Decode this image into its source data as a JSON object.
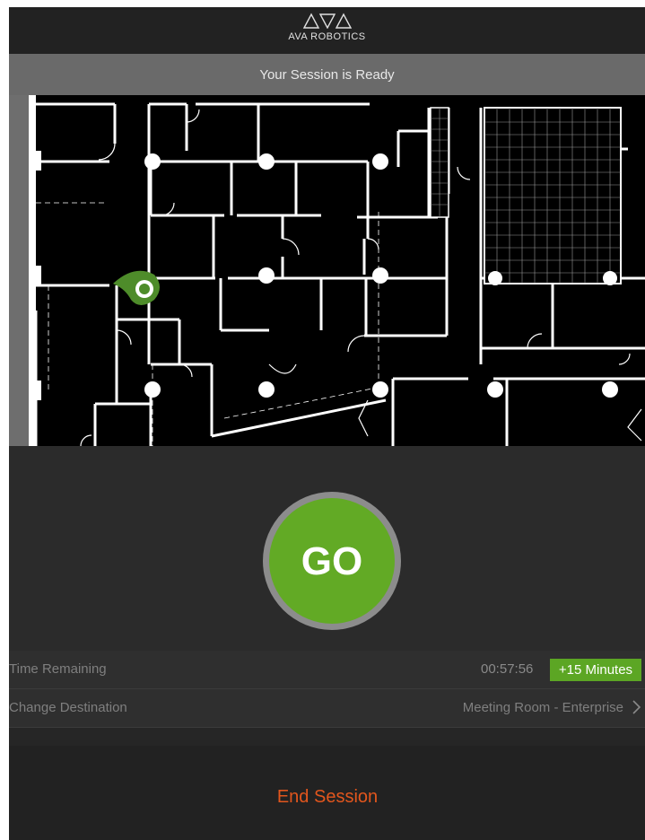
{
  "header": {
    "brand": "AVA ROBOTICS",
    "logo_icon": "ava-triangles-logo-icon"
  },
  "status": {
    "text": "Your Session is Ready"
  },
  "map": {
    "description_icon": "floor-plan-map",
    "robot_icon": "robot-location-pin-icon",
    "waypoint_icon": "waypoint-dot-icon"
  },
  "go": {
    "label": "GO",
    "color": "#62aa25"
  },
  "time_row": {
    "label": "Time Remaining",
    "value": "00:57:56",
    "extend_label": "+15 Minutes"
  },
  "destination_row": {
    "label": "Change Destination",
    "value": "Meeting Room - Enterprise",
    "chevron_icon": "chevron-right-icon"
  },
  "end_session": {
    "label": "End Session",
    "color": "#e2561d"
  }
}
